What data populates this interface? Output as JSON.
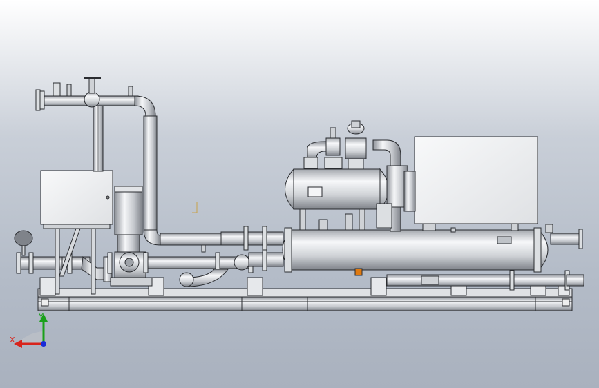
{
  "triad": {
    "x_label": "X",
    "y_label": "Y",
    "x_color": "#d8241c",
    "y_color": "#1aa01a",
    "z_color": "#1a2bd8"
  },
  "colors": {
    "metal_light": "#f4f5f7",
    "metal_mid": "#c9ccd1",
    "metal_dark": "#8d9198",
    "outline": "#2a2c30",
    "marker_orange": "#e07a10"
  }
}
